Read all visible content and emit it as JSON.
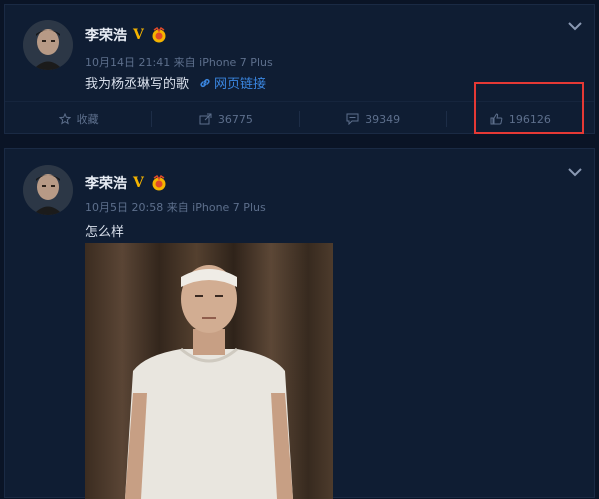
{
  "posts": [
    {
      "author": "李荣浩",
      "verified_badge": "V",
      "meta": "10月14日 21:41 来自 iPhone 7 Plus",
      "text": "我为杨丞琳写的歌",
      "link_label": "网页链接",
      "actions": {
        "collect": "收藏",
        "repost": "36775",
        "comment": "39349",
        "like": "196126"
      }
    },
    {
      "author": "李荣浩",
      "verified_badge": "V",
      "meta": "10月5日 20:58 来自 iPhone 7 Plus",
      "text": "怎么样"
    }
  ],
  "colors": {
    "background": "#0a1426",
    "card": "#0f1d33",
    "link": "#3a86e0",
    "verified": "#f5b400",
    "highlight_box": "#e53935"
  },
  "icons": {
    "collect": "star-icon",
    "repost": "share-icon",
    "comment": "comment-icon",
    "like": "thumbs-up-icon",
    "menu": "chevron-down-icon",
    "link": "link-icon"
  }
}
